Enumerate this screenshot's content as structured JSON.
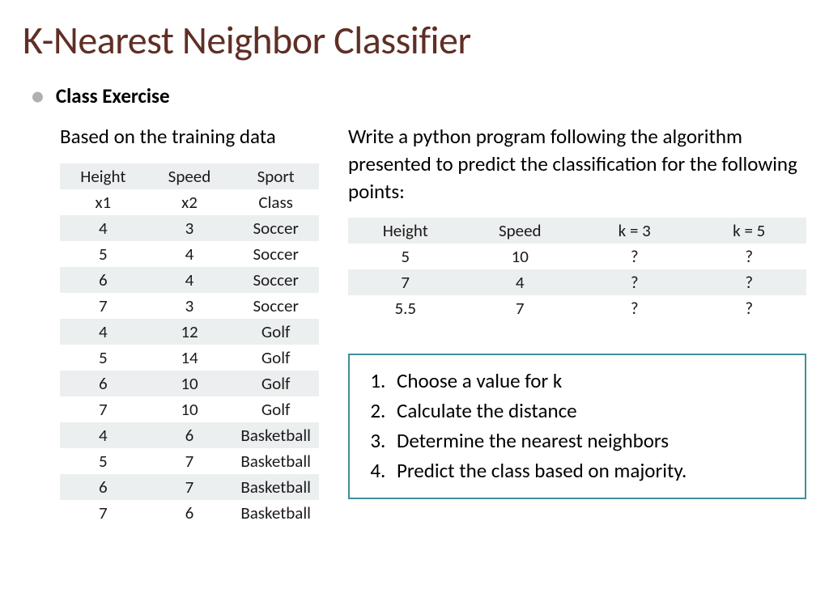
{
  "title": "K-Nearest Neighbor Classifier",
  "heading": "Class Exercise",
  "left": {
    "lead": "Based on the training data",
    "cols": {
      "h1a": "Height",
      "h2a": "Speed",
      "h3a": "Sport",
      "h1b": "x1",
      "h2b": "x2",
      "h3b": "Class"
    },
    "rows": [
      {
        "h": "4",
        "s": "3",
        "c": "Soccer"
      },
      {
        "h": "5",
        "s": "4",
        "c": "Soccer"
      },
      {
        "h": "6",
        "s": "4",
        "c": "Soccer"
      },
      {
        "h": "7",
        "s": "3",
        "c": "Soccer"
      },
      {
        "h": "4",
        "s": "12",
        "c": "Golf"
      },
      {
        "h": "5",
        "s": "14",
        "c": "Golf"
      },
      {
        "h": "6",
        "s": "10",
        "c": "Golf"
      },
      {
        "h": "7",
        "s": "10",
        "c": "Golf"
      },
      {
        "h": "4",
        "s": "6",
        "c": "Basketball"
      },
      {
        "h": "5",
        "s": "7",
        "c": "Basketball"
      },
      {
        "h": "6",
        "s": "7",
        "c": "Basketball"
      },
      {
        "h": "7",
        "s": "6",
        "c": "Basketball"
      }
    ]
  },
  "right": {
    "lead": "Write a python program following the algorithm presented to predict the classification for the following points:",
    "cols": {
      "c1": "Height",
      "c2": "Speed",
      "c3": "k = 3",
      "c4": "k = 5"
    },
    "rows": [
      {
        "h": "5",
        "s": "10",
        "k3": "?",
        "k5": "?"
      },
      {
        "h": "7",
        "s": "4",
        "k3": "?",
        "k5": "?"
      },
      {
        "h": "5.5",
        "s": "7",
        "k3": "?",
        "k5": "?"
      }
    ],
    "steps": [
      "Choose a value for k",
      "Calculate the distance",
      "Determine the nearest neighbors",
      "Predict the class based on majority."
    ]
  }
}
